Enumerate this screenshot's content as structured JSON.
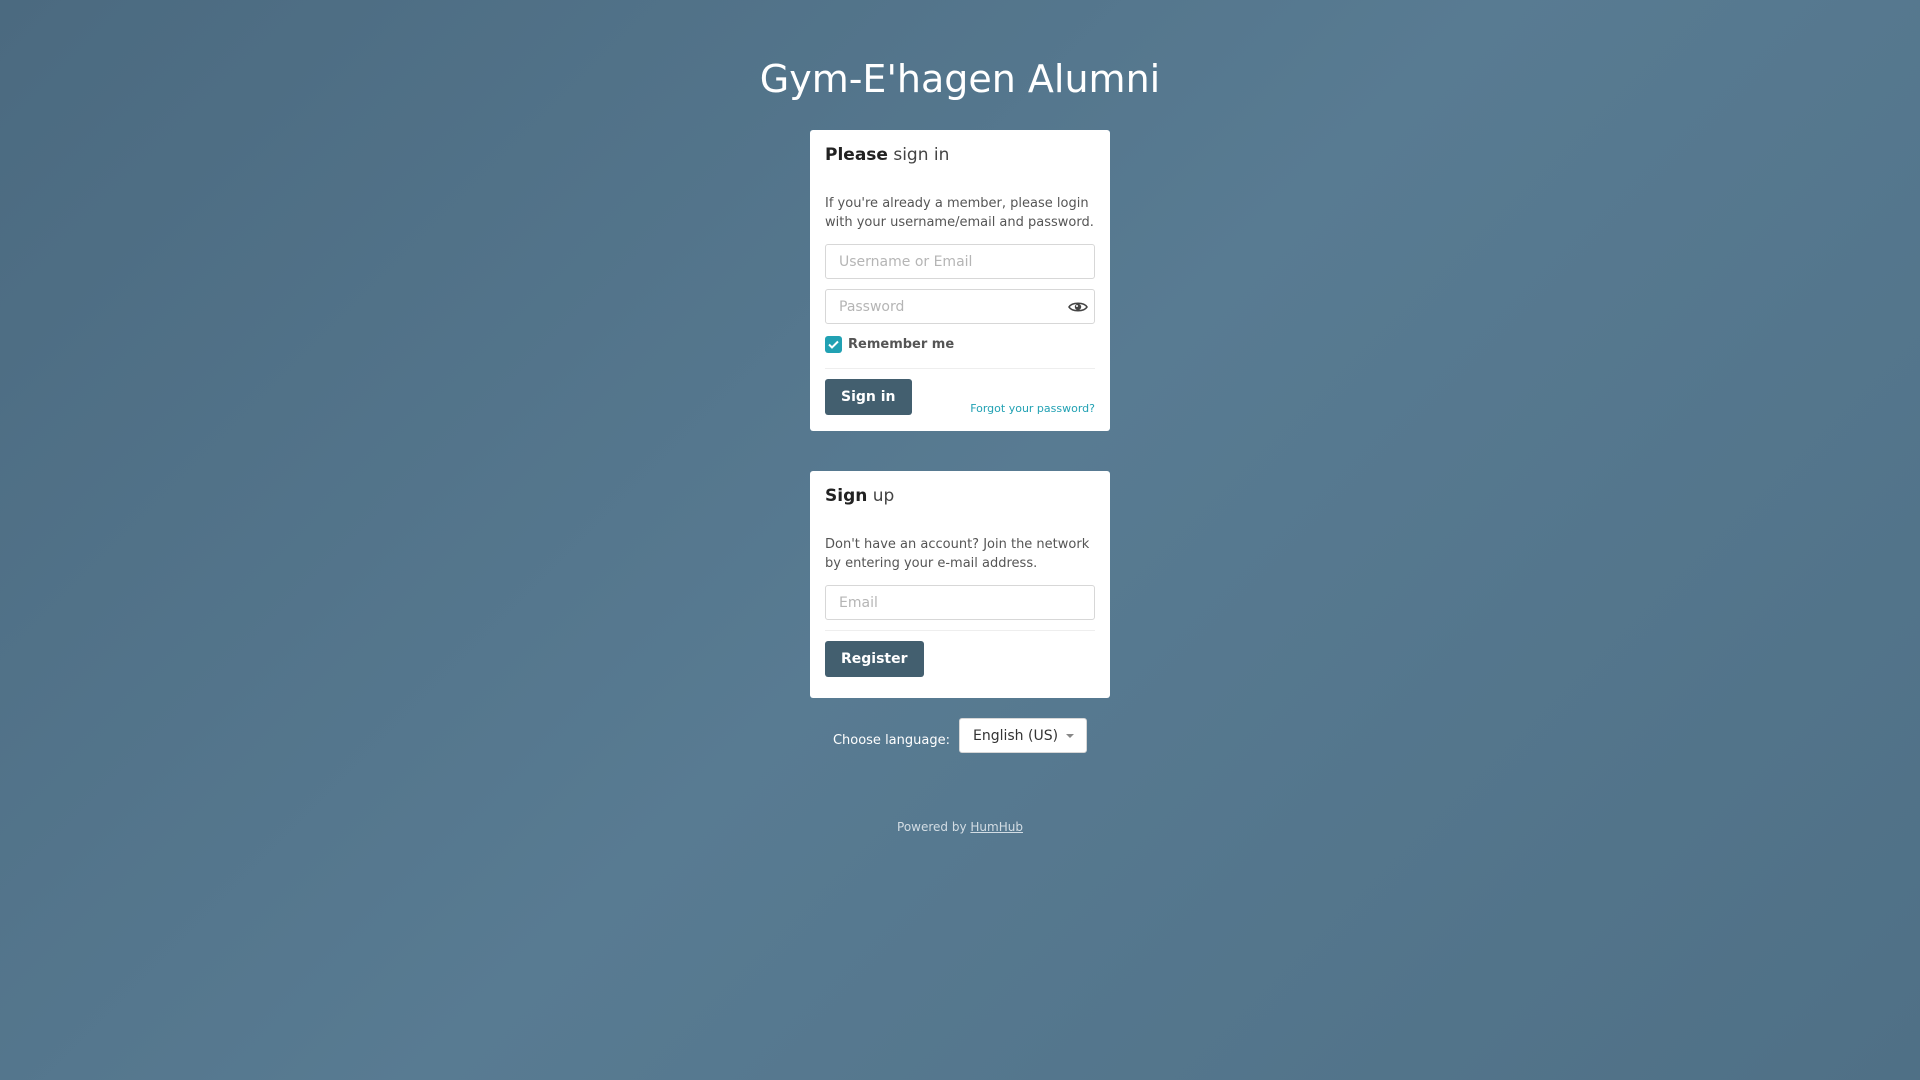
{
  "site_title": "Gym-E'hagen Alumni",
  "signin": {
    "heading_bold": "Please",
    "heading_light": "sign in",
    "description": "If you're already a member, please login with your username/email and password.",
    "username_placeholder": "Username or Email",
    "password_placeholder": "Password",
    "remember_label": "Remember me",
    "remember_checked": true,
    "submit_label": "Sign in",
    "forgot_label": "Forgot your password?",
    "show_password_icon": "eye-icon"
  },
  "signup": {
    "heading_bold": "Sign",
    "heading_light": "up",
    "description": "Don't have an account? Join the network by entering your e-mail address.",
    "email_placeholder": "Email",
    "submit_label": "Register"
  },
  "language": {
    "label": "Choose language:",
    "selected": "English (US)"
  },
  "footer": {
    "powered_prefix": "Powered by",
    "powered_link": "HumHub"
  },
  "colors": {
    "accent": "#21a1b3",
    "button": "#435f6f",
    "background": "#587b92"
  }
}
